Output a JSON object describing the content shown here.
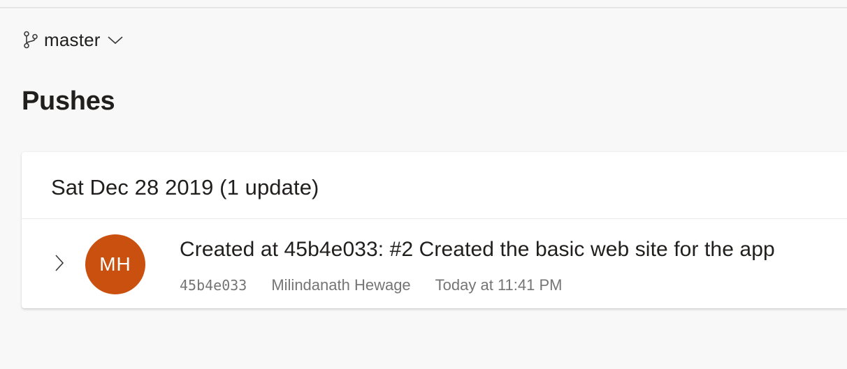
{
  "branch": {
    "name": "master",
    "icon": "branch-icon",
    "dropdown_icon": "chevron-down-icon"
  },
  "page": {
    "title": "Pushes"
  },
  "push_groups": [
    {
      "header": "Sat Dec 28 2019 (1 update)",
      "items": [
        {
          "avatar_initials": "MH",
          "avatar_color": "#ca5010",
          "title": "Created at 45b4e033: #2 Created the basic web site for the app",
          "commit_id": "45b4e033",
          "author": "Milindanath Hewage",
          "time": "Today at 11:41 PM",
          "expand_icon": "chevron-right-icon"
        }
      ]
    }
  ]
}
